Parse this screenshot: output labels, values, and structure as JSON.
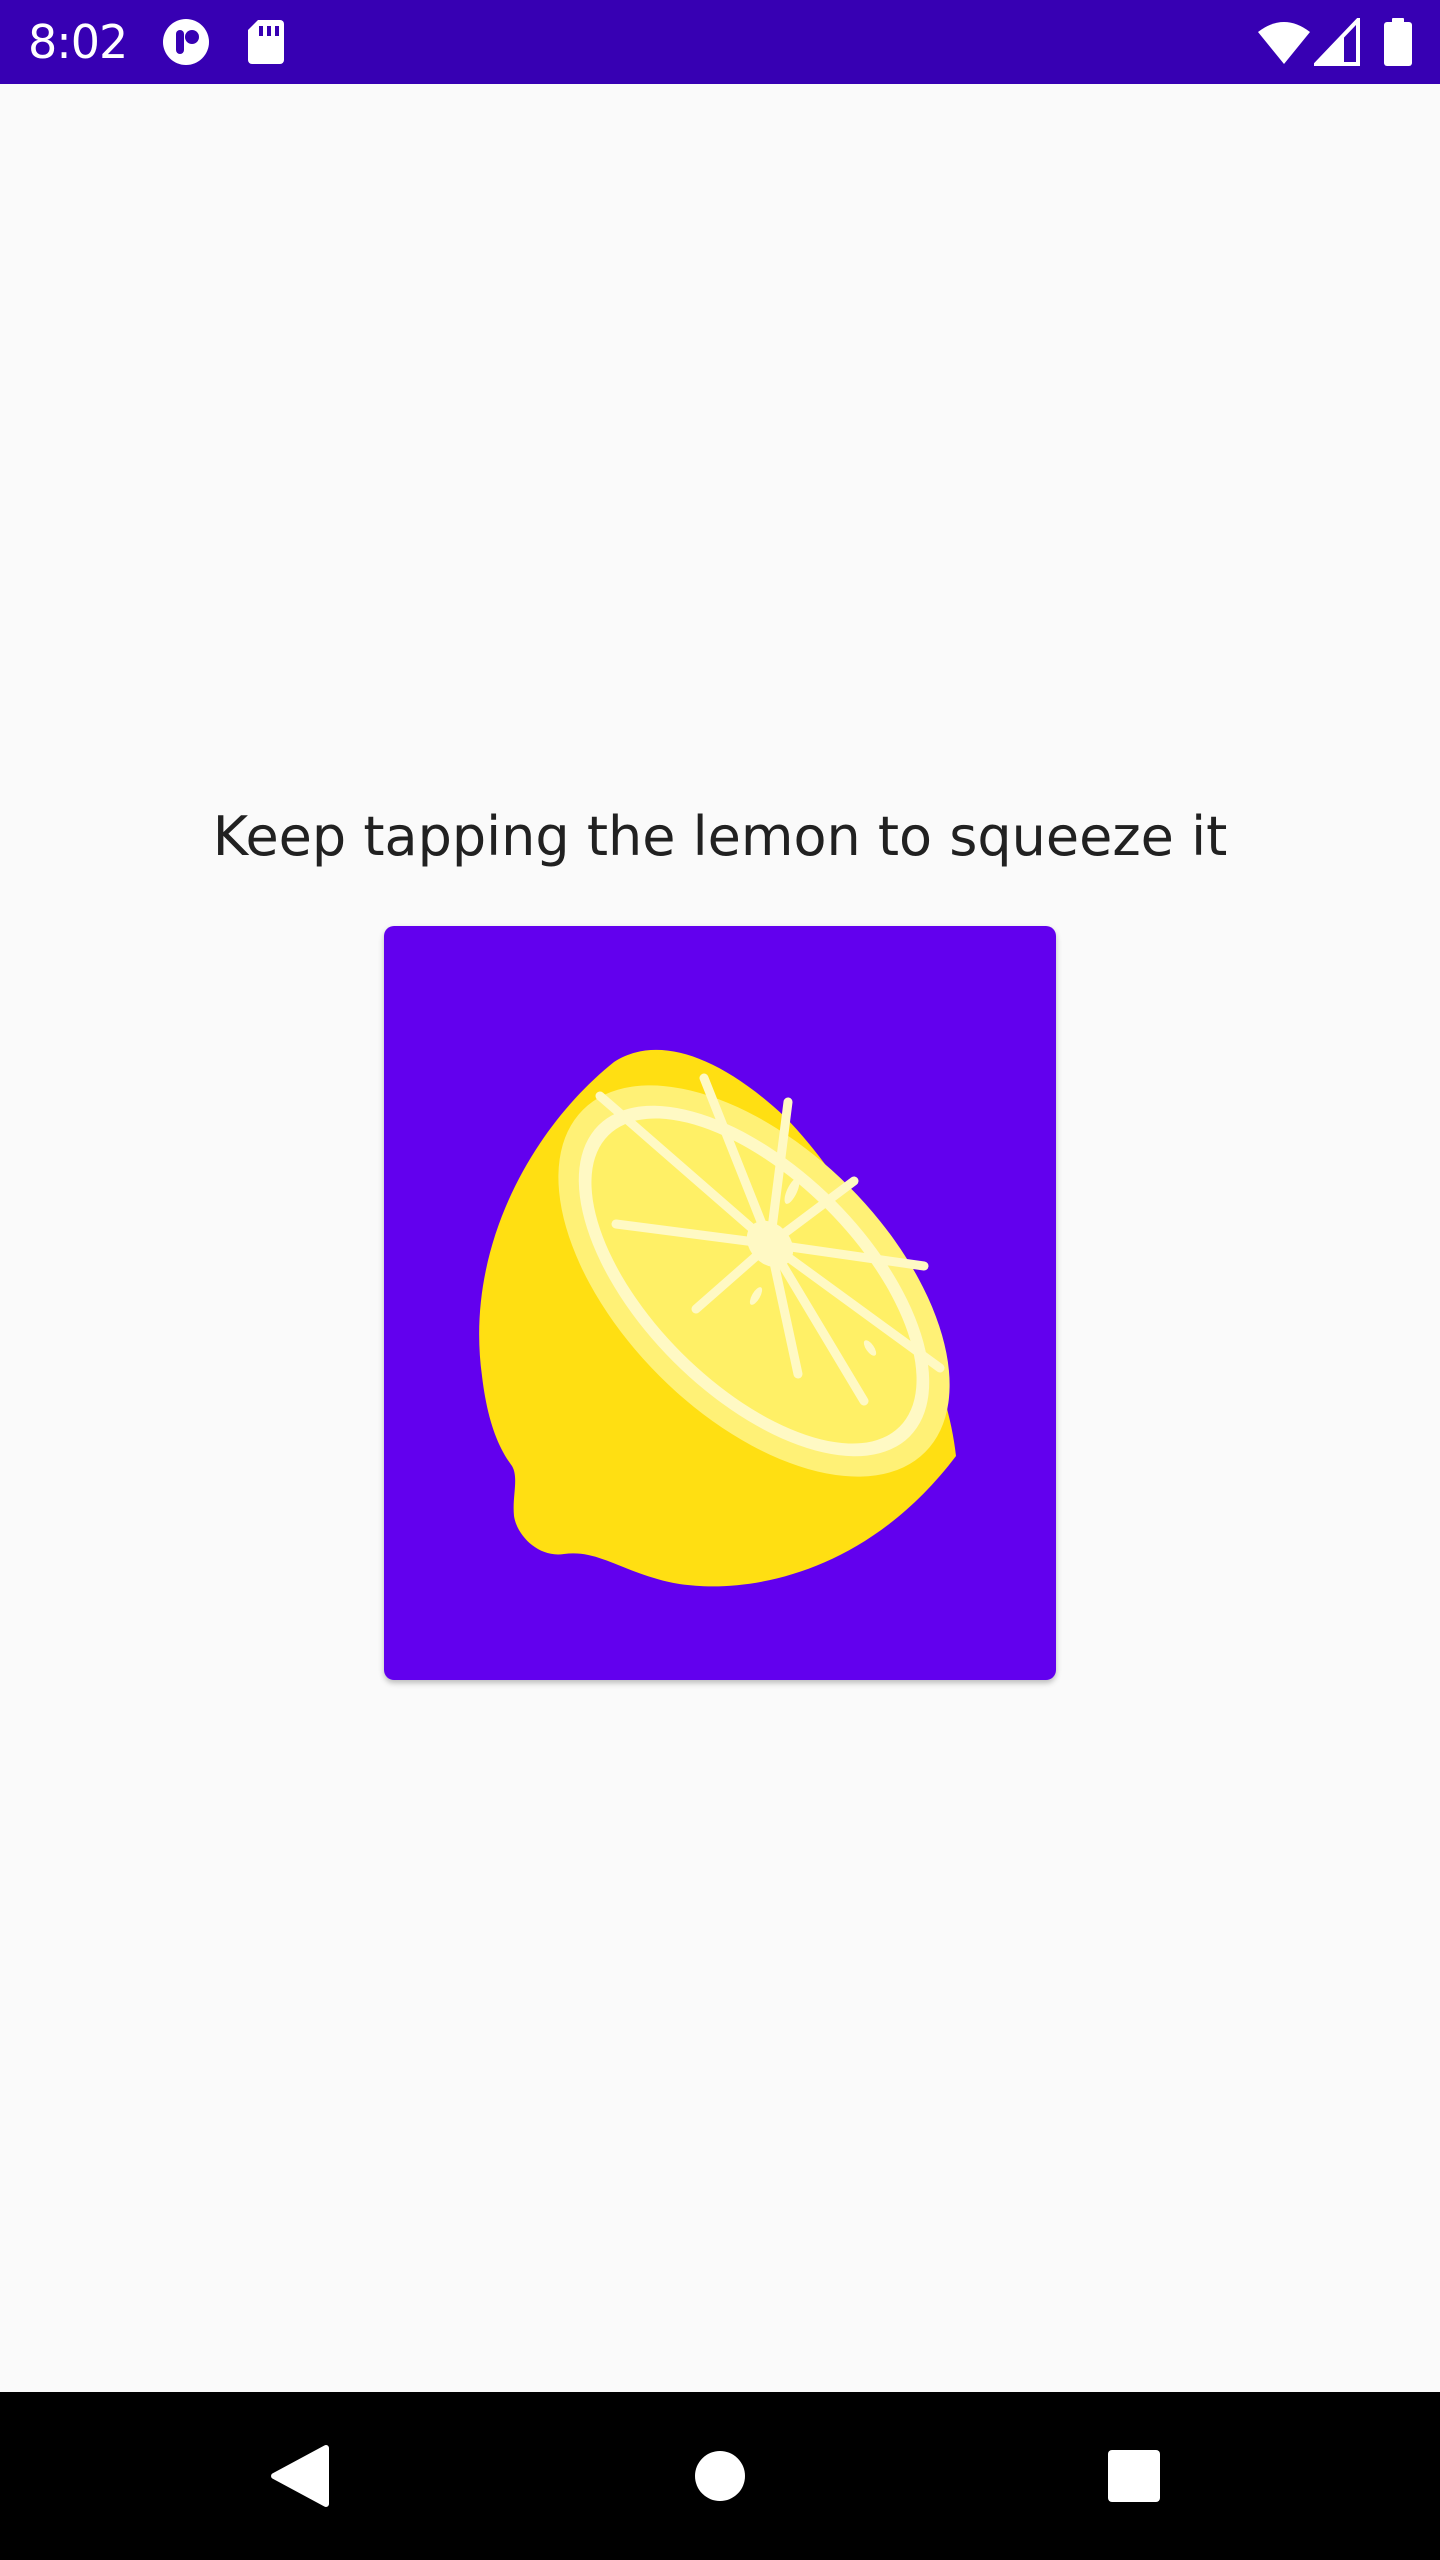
{
  "status_bar": {
    "time": "8:02",
    "background_color": "#3700b3",
    "left_icons": [
      "app-notification-icon",
      "sd-card-icon"
    ],
    "right_icons": [
      "wifi-icon",
      "cell-signal-icon",
      "battery-icon"
    ]
  },
  "main": {
    "instruction_text": "Keep tapping the lemon to squeeze it",
    "lemon_image": {
      "icon": "lemon-squeeze-icon",
      "background_color": "#6200ee"
    }
  },
  "nav_bar": {
    "buttons": [
      "back-icon",
      "home-icon",
      "recents-icon"
    ]
  }
}
